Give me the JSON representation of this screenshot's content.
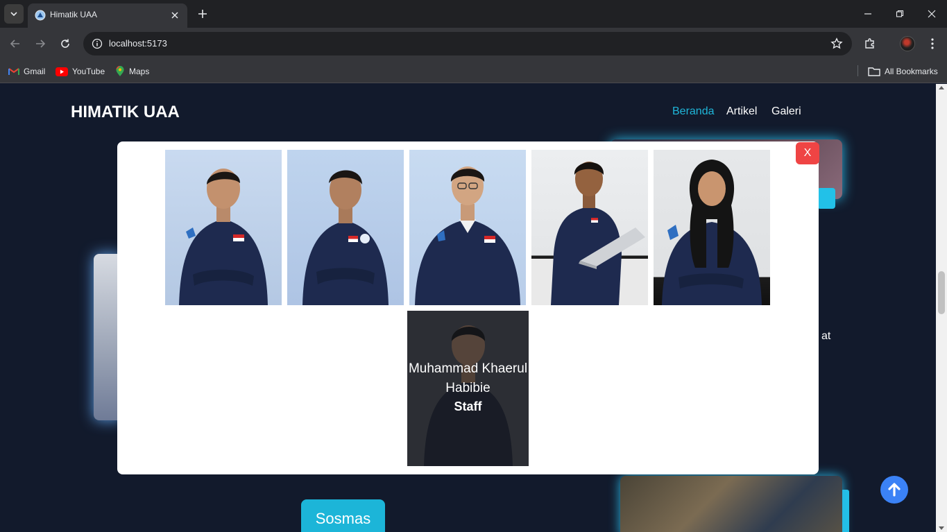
{
  "browser": {
    "tab_title": "Himatik UAA",
    "url": "localhost:5173",
    "bookmarks": [
      {
        "label": "Gmail",
        "icon": "gmail-icon"
      },
      {
        "label": "YouTube",
        "icon": "youtube-icon"
      },
      {
        "label": "Maps",
        "icon": "maps-icon"
      }
    ],
    "all_bookmarks": "All Bookmarks"
  },
  "header": {
    "brand": "HIMATIK UAA",
    "nav": [
      {
        "label": "Beranda",
        "active": true
      },
      {
        "label": "Artikel",
        "active": false
      },
      {
        "label": "Galeri",
        "active": false
      }
    ]
  },
  "background": {
    "partial_text": "at",
    "category_button": "Sosmas"
  },
  "modal": {
    "close_label": "X",
    "members": [
      {
        "name": "",
        "role": ""
      },
      {
        "name": "",
        "role": ""
      },
      {
        "name": "",
        "role": ""
      },
      {
        "name": "",
        "role": ""
      },
      {
        "name": "",
        "role": ""
      },
      {
        "name": "Muhammad Khaerul Habibie",
        "role": "Staff",
        "hovered": true
      }
    ]
  },
  "colors": {
    "page_bg": "#121a2c",
    "accent": "#1fb6d9",
    "close_button": "#ef4444",
    "scroll_top_button": "#3b82f6"
  }
}
